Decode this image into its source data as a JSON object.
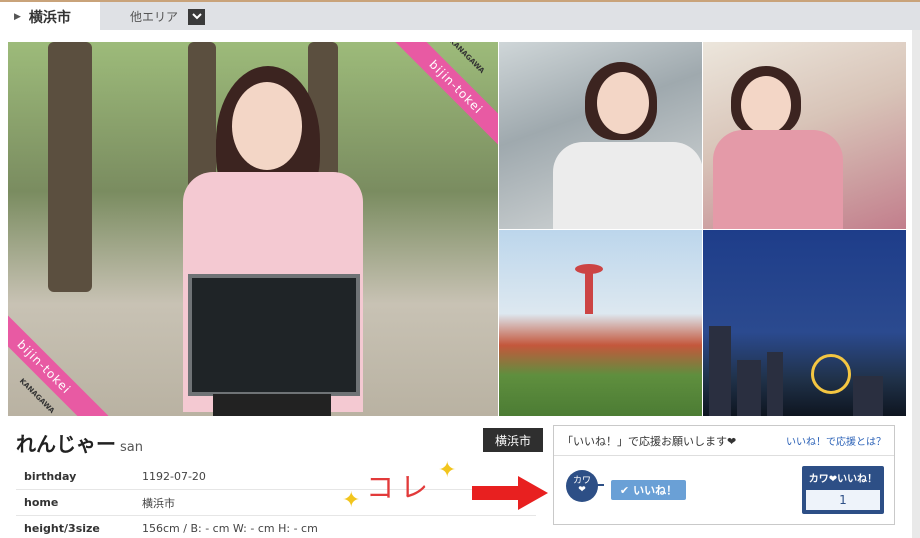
{
  "area_nav": {
    "current_area": "横浜市",
    "other_area_label": "他エリア"
  },
  "photos": {
    "ribbon_text": "bijin-tokei",
    "ribbon_region": "KANAGAWA"
  },
  "profile": {
    "name": "れんじゃー",
    "honorific": "san",
    "city_badge": "横浜市",
    "rows": [
      {
        "label": "birthday",
        "value": "1192-07-20"
      },
      {
        "label": "home",
        "value": "横浜市"
      },
      {
        "label": "height/3size",
        "value": "156cm / B: - cm W: - cm H: - cm"
      }
    ]
  },
  "annotation": {
    "text": "コレ"
  },
  "like_panel": {
    "request_text": "「いいね！」で応援お願いします❤",
    "help_link": "いいね！で応援とは？",
    "avatar_text": "カワ",
    "avatar_heart": "❤",
    "like_button_label": "いいね！",
    "counter_label": "カワ❤いいね！",
    "counter_value": "1"
  },
  "colors": {
    "ribbon": "#e85aa3",
    "accent_blue": "#2d4f86",
    "like_button": "#6aa0d6",
    "annotation_red": "#e23a3a",
    "sparkle_yellow": "#f2c51d"
  }
}
